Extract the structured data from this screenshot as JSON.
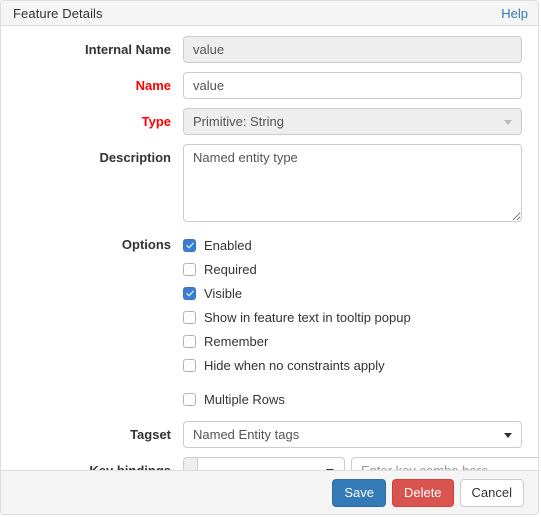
{
  "panel": {
    "title": "Feature Details",
    "help_label": "Help"
  },
  "form": {
    "internal_name": {
      "label": "Internal Name",
      "value": "value"
    },
    "name": {
      "label": "Name",
      "value": "value"
    },
    "type": {
      "label": "Type",
      "value": "Primitive: String"
    },
    "description": {
      "label": "Description",
      "value": "Named entity type"
    },
    "options": {
      "label": "Options",
      "items": [
        {
          "label": "Enabled",
          "checked": true
        },
        {
          "label": "Required",
          "checked": false
        },
        {
          "label": "Visible",
          "checked": true
        },
        {
          "label": "Show in feature text in tooltip popup",
          "checked": false
        },
        {
          "label": "Remember",
          "checked": false
        },
        {
          "label": "Hide when no constraints apply",
          "checked": false
        },
        {
          "label": "Multiple Rows",
          "checked": false
        }
      ]
    },
    "tagset": {
      "label": "Tagset",
      "value": "Named Entity tags"
    },
    "key_bindings": {
      "label": "Key bindings",
      "select_value": "",
      "combo_placeholder": "Enter key combo here...",
      "add_label": "+"
    }
  },
  "footer": {
    "save_label": "Save",
    "delete_label": "Delete",
    "cancel_label": "Cancel"
  },
  "colors": {
    "primary": "#337ab7",
    "danger": "#d9534f",
    "required": "#ff0000",
    "checkbox": "#3c7fd0",
    "link": "#337ab7"
  }
}
